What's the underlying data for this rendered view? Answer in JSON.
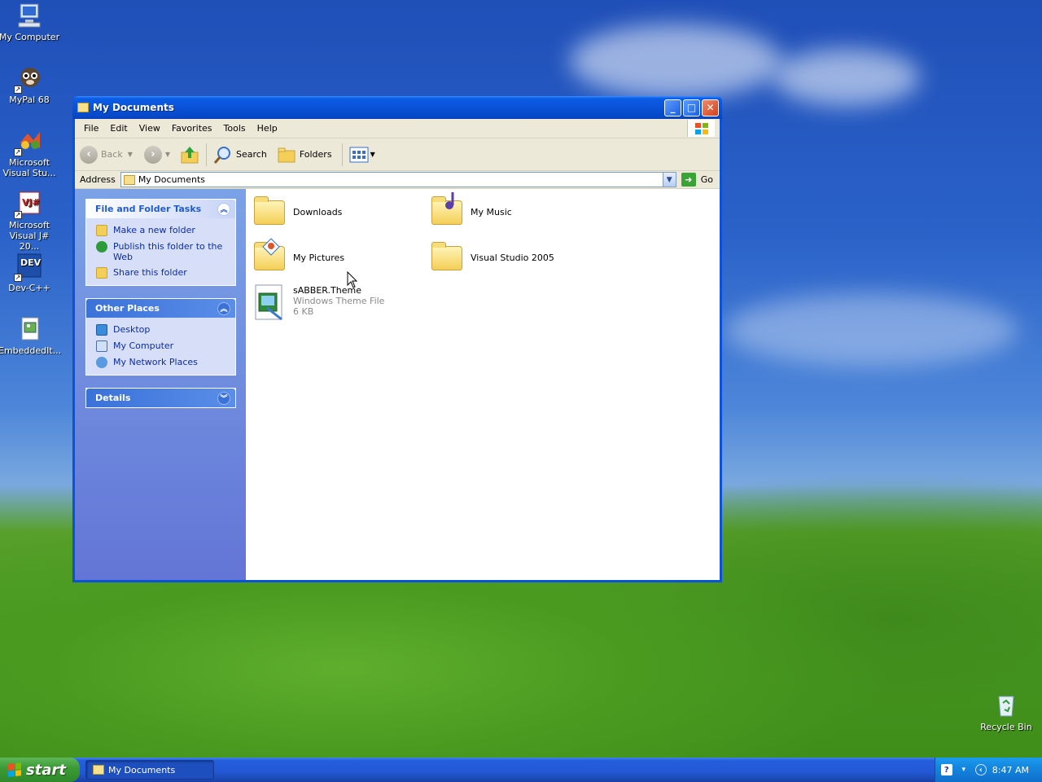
{
  "desktop": {
    "icons": [
      {
        "label": "My Computer",
        "icon": "my-computer-icon"
      },
      {
        "label": "MyPal 68",
        "icon": "mypal-icon"
      },
      {
        "label": "Microsoft Visual Stu...",
        "icon": "visual-studio-icon"
      },
      {
        "label": "Microsoft Visual J# 20...",
        "icon": "visual-jsharp-icon"
      },
      {
        "label": "Dev-C++",
        "icon": "devcpp-icon"
      },
      {
        "label": "EmbeddedIt...",
        "icon": "embedded-image-icon"
      },
      {
        "label": "Recycle Bin",
        "icon": "recycle-bin-icon"
      }
    ]
  },
  "window": {
    "title": "My Documents",
    "menu": [
      "File",
      "Edit",
      "View",
      "Favorites",
      "Tools",
      "Help"
    ],
    "toolbar": {
      "back": "Back",
      "search": "Search",
      "folders": "Folders"
    },
    "address": {
      "label": "Address",
      "value": "My Documents",
      "go": "Go"
    },
    "taskpane": {
      "file_tasks": {
        "title": "File and Folder Tasks",
        "items": [
          "Make a new folder",
          "Publish this folder to the Web",
          "Share this folder"
        ]
      },
      "other_places": {
        "title": "Other Places",
        "items": [
          "Desktop",
          "My Computer",
          "My Network Places"
        ]
      },
      "details": {
        "title": "Details"
      }
    },
    "files": [
      {
        "name": "Downloads",
        "type": "folder"
      },
      {
        "name": "My Music",
        "type": "music-folder"
      },
      {
        "name": "My Pictures",
        "type": "pictures-folder"
      },
      {
        "name": "Visual Studio 2005",
        "type": "folder"
      },
      {
        "name": "sABBER.Theme",
        "type": "theme-file",
        "kind": "Windows Theme File",
        "size": "6 KB"
      }
    ]
  },
  "taskbar": {
    "start": "start",
    "task": "My Documents",
    "clock": "8:47 AM"
  },
  "colors": {
    "title_blue": "#0a52d8",
    "taskpane_link": "#0c2ca0",
    "start_green": "#3d9c36"
  }
}
